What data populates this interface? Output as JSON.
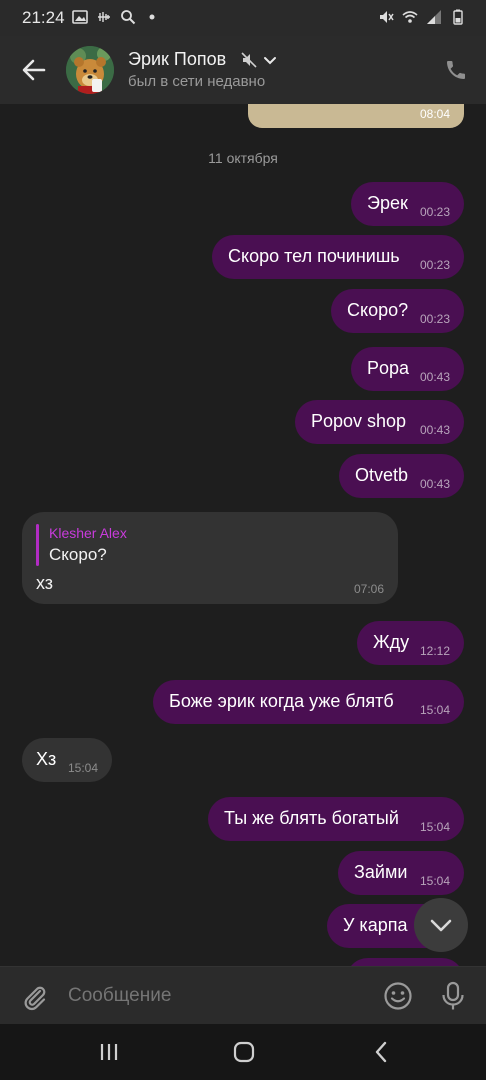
{
  "status_bar": {
    "time": "21:24",
    "left_icons": [
      "image-icon",
      "voicemail-icon",
      "search-icon",
      "dot-icon"
    ],
    "right_icons": [
      "mute-icon",
      "wifi-icon",
      "signal-icon",
      "battery-icon"
    ]
  },
  "header": {
    "contact_name": "Эрик Попов",
    "contact_status": "был в сети недавно",
    "icons": [
      "back-arrow-icon",
      "muted-icon",
      "chevron-down-icon",
      "phone-icon"
    ]
  },
  "chat": {
    "top_photo_time": "08:04",
    "date_separator": "11 октября",
    "messages": [
      {
        "text": "Эрек",
        "time": "00:23",
        "direction": "outgoing"
      },
      {
        "text": "Скоро тел починишь",
        "time": "00:23",
        "direction": "outgoing"
      },
      {
        "text": "Скоро?",
        "time": "00:23",
        "direction": "outgoing"
      },
      {
        "text": "Popa",
        "time": "00:43",
        "direction": "outgoing"
      },
      {
        "text": "Popov shop",
        "time": "00:43",
        "direction": "outgoing"
      },
      {
        "text": "Otvetb",
        "time": "00:43",
        "direction": "outgoing"
      },
      {
        "reply_author": "Klesher Alex",
        "reply_quote": "Скоро?",
        "text": "хз",
        "time": "07:06",
        "direction": "incoming"
      },
      {
        "text": "Жду",
        "time": "12:12",
        "direction": "outgoing"
      },
      {
        "text": "Боже эрик когда уже блятб",
        "time": "15:04",
        "direction": "outgoing"
      },
      {
        "text": "Хз",
        "time": "15:04",
        "direction": "incoming"
      },
      {
        "text": "Ты же блять богатый",
        "time": "15:04",
        "direction": "outgoing"
      },
      {
        "text": "Займи",
        "time": "15:04",
        "direction": "outgoing"
      },
      {
        "text": "У карпа",
        "time": "",
        "direction": "outgoing"
      }
    ]
  },
  "composer": {
    "placeholder": "Сообщение",
    "icons": [
      "attach-icon",
      "emoji-icon",
      "microphone-icon"
    ]
  },
  "colors": {
    "outgoing_bubble": "#4a0f52",
    "incoming_bubble": "#333333",
    "reply_accent": "#c93bdc",
    "background": "#1e1e1e"
  }
}
